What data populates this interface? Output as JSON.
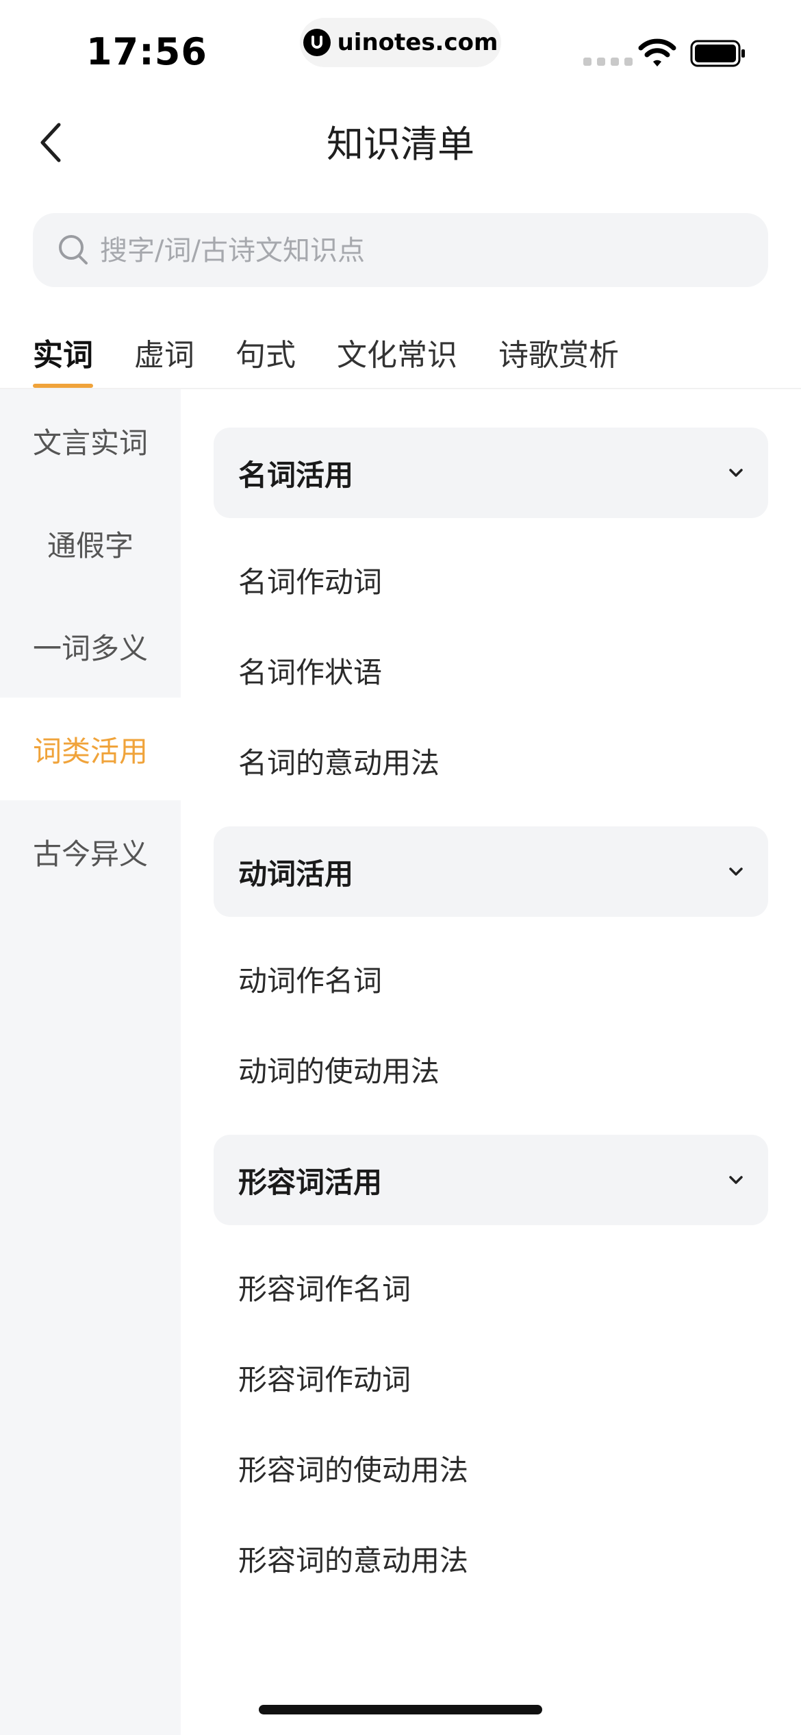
{
  "status_bar": {
    "time": "17:56",
    "url": "uinotes.com",
    "icons": [
      "signal-icon",
      "wifi-icon",
      "battery-icon"
    ]
  },
  "nav": {
    "title": "知识清单",
    "back_icon": "chevron-left-icon"
  },
  "search": {
    "placeholder": "搜字/词/古诗文知识点",
    "value": ""
  },
  "tabs": [
    {
      "label": "实词",
      "active": true
    },
    {
      "label": "虚词",
      "active": false
    },
    {
      "label": "句式",
      "active": false
    },
    {
      "label": "文化常识",
      "active": false
    },
    {
      "label": "诗歌赏析",
      "active": false
    }
  ],
  "sidebar": {
    "items": [
      {
        "label": "文言实词",
        "active": false
      },
      {
        "label": "通假字",
        "active": false
      },
      {
        "label": "一词多义",
        "active": false
      },
      {
        "label": "词类活用",
        "active": true
      },
      {
        "label": "古今异义",
        "active": false
      }
    ]
  },
  "groups": [
    {
      "title": "名词活用",
      "items": [
        "名词作动词",
        "名词作状语",
        "名词的意动用法"
      ]
    },
    {
      "title": "动词活用",
      "items": [
        "动词作名词",
        "动词的使动用法"
      ]
    },
    {
      "title": "形容词活用",
      "items": [
        "形容词作名词",
        "形容词作动词",
        "形容词的使动用法",
        "形容词的意动用法"
      ]
    }
  ],
  "colors": {
    "accent": "#f0a33a",
    "sidebar_bg": "#f5f6f8",
    "card_bg": "#f3f4f6"
  }
}
